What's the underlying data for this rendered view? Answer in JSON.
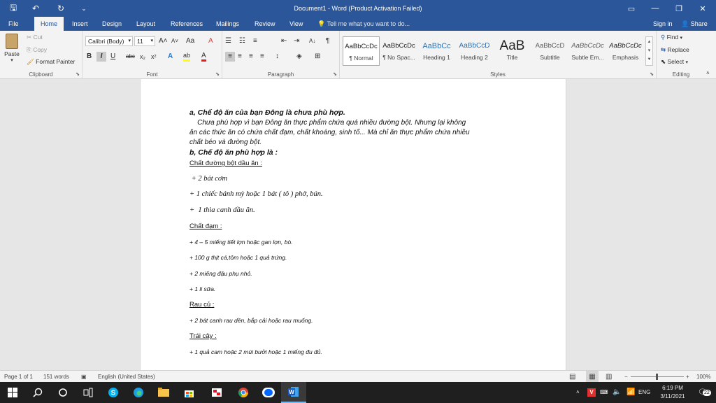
{
  "window": {
    "title": "Document1 - Word (Product Activation Failed)",
    "quick_access": {
      "save": "🖫",
      "undo": "↶",
      "redo": "↻",
      "customize": "⌄"
    },
    "controls": {
      "ribbon_display": "▭",
      "minimize": "—",
      "restore": "❐",
      "close": "✕"
    }
  },
  "tabs": [
    "File",
    "Home",
    "Insert",
    "Design",
    "Layout",
    "References",
    "Mailings",
    "Review",
    "View"
  ],
  "tell_me": "Tell me what you want to do...",
  "account": {
    "sign_in": "Sign in",
    "share": "Share"
  },
  "ribbon": {
    "clipboard": {
      "paste": "Paste",
      "cut": "Cut",
      "copy": "Copy",
      "format_painter": "Format Painter",
      "label": "Clipboard"
    },
    "font": {
      "name": "Calibri (Body)",
      "size": "11",
      "label": "Font",
      "bold": "B",
      "italic": "I",
      "underline": "U",
      "strike": "abc",
      "subscript": "x₂",
      "superscript": "x²",
      "grow": "A˄",
      "shrink": "A˅",
      "case": "Aa",
      "clear": "A",
      "effects": "A",
      "highlight": "ab",
      "color": "A"
    },
    "paragraph": {
      "label": "Paragraph",
      "sort": "A↓",
      "pilcrow": "¶"
    },
    "styles": {
      "label": "Styles",
      "items": [
        {
          "sample": "AaBbCcDc",
          "name": "¶ Normal"
        },
        {
          "sample": "AaBbCcDc",
          "name": "¶ No Spac..."
        },
        {
          "sample": "AaBbCc",
          "name": "Heading 1"
        },
        {
          "sample": "AaBbCcD",
          "name": "Heading 2"
        },
        {
          "sample": "AaB",
          "name": "Title"
        },
        {
          "sample": "AaBbCcD",
          "name": "Subtitle"
        },
        {
          "sample": "AaBbCcDc",
          "name": "Subtle Em..."
        },
        {
          "sample": "AaBbCcDc",
          "name": "Emphasis"
        }
      ]
    },
    "editing": {
      "find": "Find",
      "replace": "Replace",
      "select": "Select",
      "label": "Editing"
    }
  },
  "document": {
    "lines": [
      {
        "text": "a, Chế độ ăn của bạn Đông là chưa phù hợp.",
        "style": "b"
      },
      {
        "text": "    Chưa phù hợp vì bạn Đông ăn thực phẩm chứa quá nhiều đường bột. Nhưng lại không",
        "style": "p"
      },
      {
        "text": "ăn các thức ăn có chứa chất đạm, chất khoáng, sinh tố... Mà chỉ ăn thực phẩm chứa nhiều",
        "style": "p"
      },
      {
        "text": "chất béo và đường bột.",
        "style": "p"
      },
      {
        "text": "b, Chế độ ăn phù hợp là :",
        "style": "b"
      },
      {
        "text": "Chất đường bột dầu ăn :",
        "style": "u"
      },
      {
        "text": " + 2 bát cơm",
        "style": "serif"
      },
      {
        "text": "+ 1 chiếc bánh mỳ hoặc 1 bát ( tô ) phở, bún.",
        "style": "serif"
      },
      {
        "text": "+  1 thìa canh dầu ăn.",
        "style": "serif"
      },
      {
        "text": "Chất đạm :",
        "style": "u"
      },
      {
        "text": "+ 4 – 5 miếng tiết lợn hoặc gan lợn, bò.",
        "style": "sm"
      },
      {
        "text": "+ 100 g thịt cá,tôm hoặc 1 quả trứng.",
        "style": "sm"
      },
      {
        "text": "+ 2 miếng đậu phụ nhỏ.",
        "style": "sm"
      },
      {
        "text": "+ 1 li sữa.",
        "style": "sm"
      },
      {
        "text": "Rau củ :",
        "style": "u"
      },
      {
        "text": "+ 2 bát canh rau dền, bắp cải hoặc rau muống.",
        "style": "sm"
      },
      {
        "text": "Trái cây :",
        "style": "u"
      },
      {
        "text": "+ 1 quả cam hoặc 2 múi bưởi hoặc 1 miếng đu đủ.",
        "style": "sm"
      }
    ]
  },
  "status": {
    "page": "Page 1 of 1",
    "words": "151 words",
    "language": "English (United States)",
    "zoom": "100%"
  },
  "taskbar": {
    "apps": [
      "start",
      "search",
      "cortana",
      "task-view",
      "skype",
      "edge",
      "file-explorer",
      "store",
      "snipping-tool",
      "chrome",
      "zalo",
      "word"
    ],
    "tray": {
      "keyboard": "ENG",
      "time": "6:19 PM",
      "date": "3/11/2021",
      "notifications": "22"
    }
  }
}
